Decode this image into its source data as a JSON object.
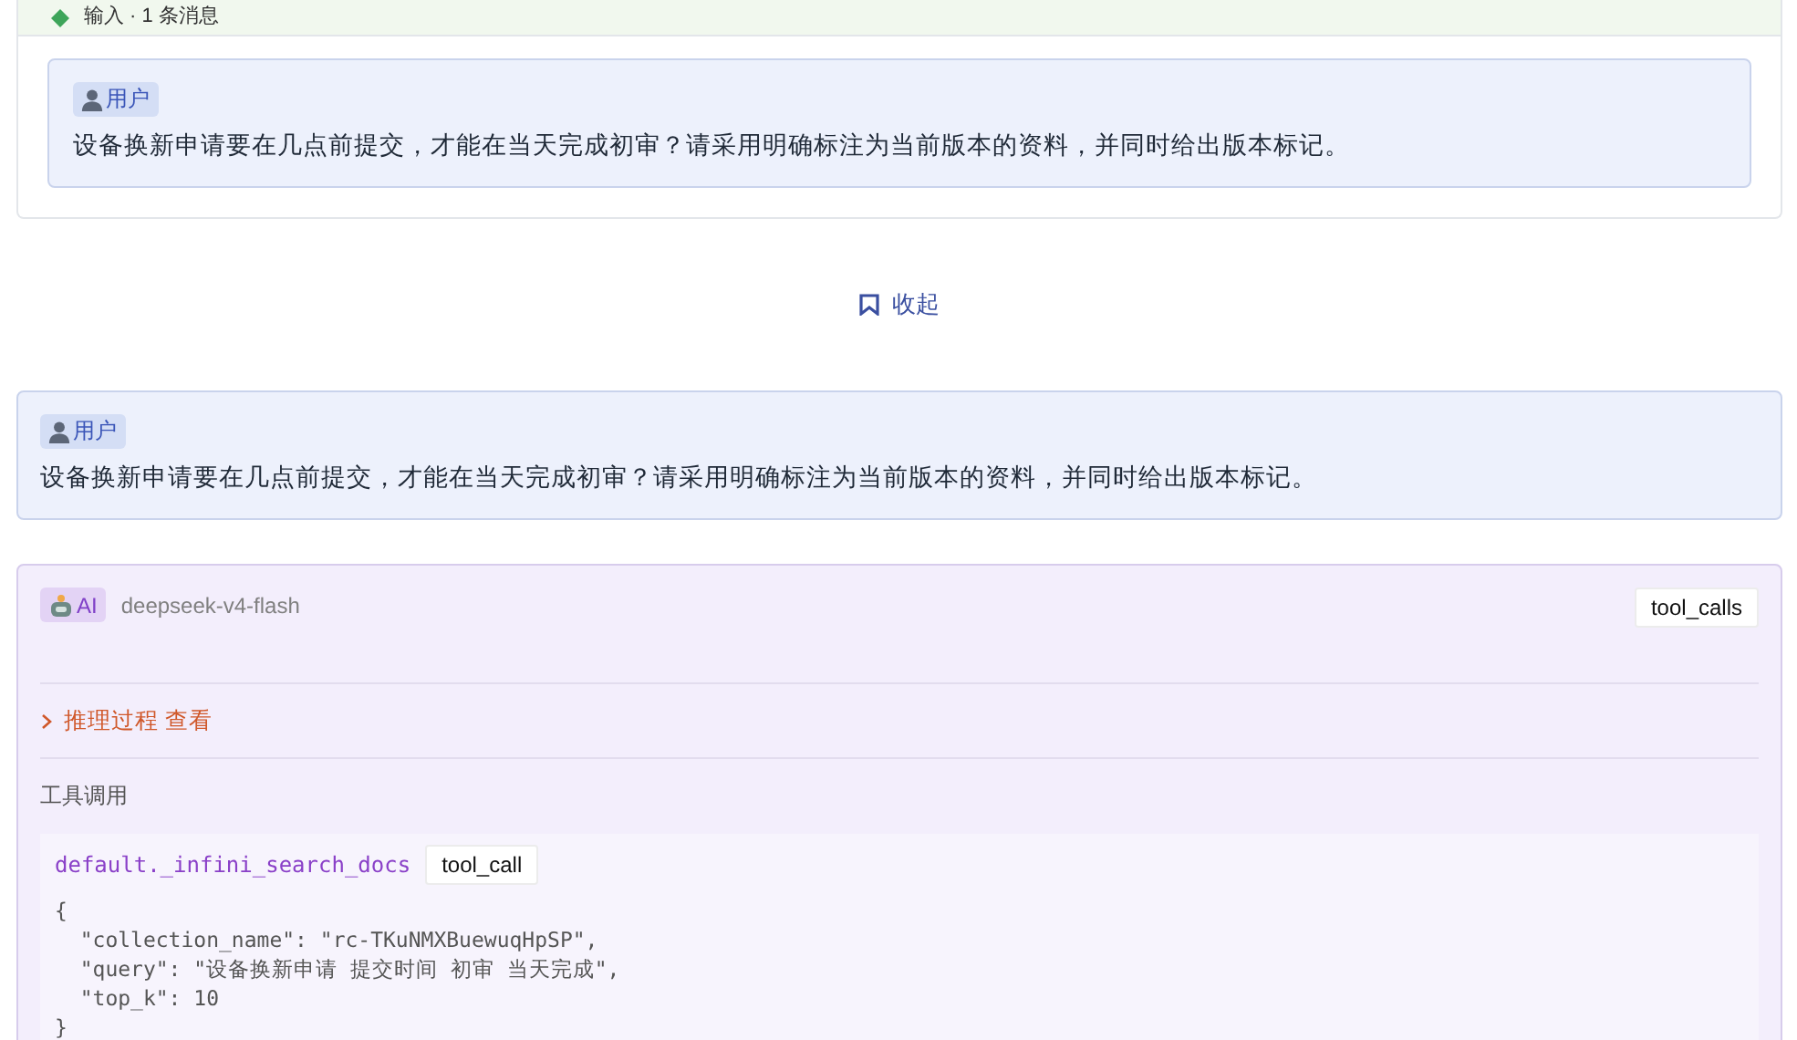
{
  "input_group": {
    "title": "输入 · 1 条消息",
    "messages": [
      {
        "role": "用户",
        "text": "设备换新申请要在几点前提交，才能在当天完成初审？请采用明确标注为当前版本的资料，并同时给出版本标记。"
      }
    ]
  },
  "collapse": {
    "label": "收起"
  },
  "conversation": [
    {
      "kind": "user",
      "role": "用户",
      "text": "设备换新申请要在几点前提交，才能在当天完成初审？请采用明确标注为当前版本的资料，并同时给出版本标记。"
    },
    {
      "kind": "ai",
      "role": "AI",
      "model": "deepseek-v4-flash",
      "finish_tag": "tool_calls",
      "reasoning": {
        "label": "推理过程 查看",
        "expanded": false
      },
      "tools_label": "工具调用",
      "tool_calls": [
        {
          "name": "default._infini_search_docs",
          "tag": "tool_call",
          "args": [
            "{",
            "  \"collection_name\": \"rc-TKuNMXBuewuqHpSP\",",
            "  \"query\": \"设备换新申请 提交时间 初审 当天完成\",",
            "  \"top_k\": 10",
            "}"
          ]
        }
      ]
    }
  ]
}
